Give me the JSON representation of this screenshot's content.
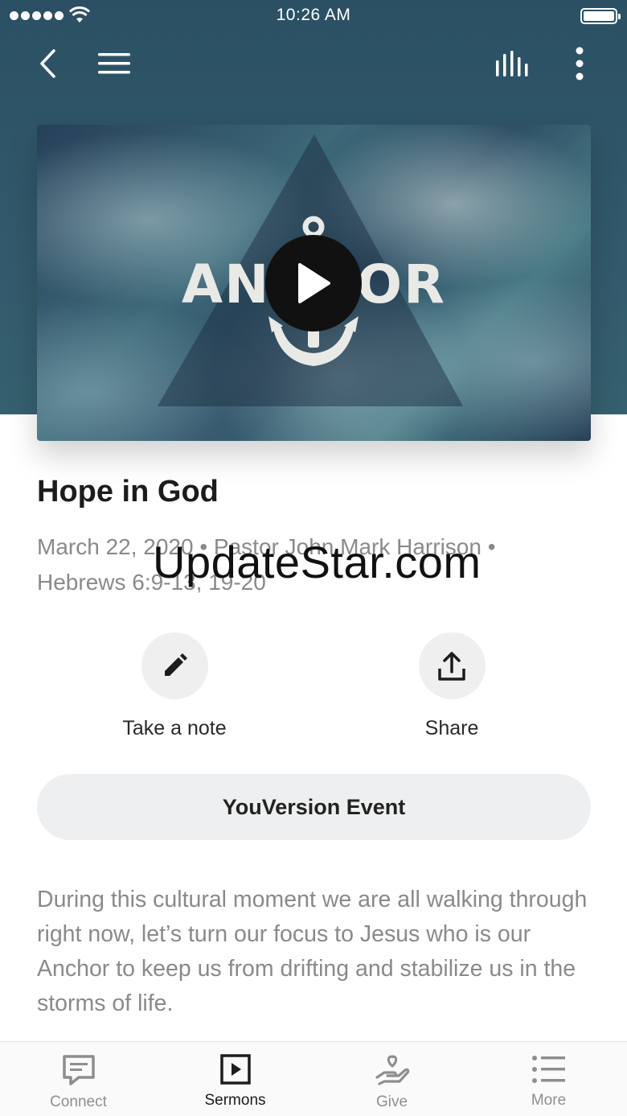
{
  "status_bar": {
    "time": "10:26 AM",
    "signal_bars": 5
  },
  "nav": {
    "back_icon": "chevron-left-icon",
    "menu_icon": "hamburger-menu-icon",
    "audio_icon": "audio-bars-icon",
    "more_icon": "more-vertical-icon"
  },
  "video": {
    "cover_text": "ANCHOR",
    "play_icon": "play-icon"
  },
  "sermon": {
    "title": "Hope in God",
    "meta_line1": "March 22, 2020 • Pastor John Mark Harrison •",
    "meta_line2": "Hebrews 6:9-13, 19-20",
    "watermark": "UpdateStar.com",
    "description": "During this cultural moment we are all walking through right now, let’s turn our focus to Jesus who is our Anchor to keep us from drifting and stabilize us in the storms of life."
  },
  "actions": {
    "note_label": "Take a note",
    "share_label": "Share",
    "event_label": "YouVersion Event"
  },
  "tabs": [
    {
      "label": "Connect",
      "icon": "message-icon",
      "active": false
    },
    {
      "label": "Sermons",
      "icon": "video-play-icon",
      "active": true
    },
    {
      "label": "Give",
      "icon": "hand-heart-icon",
      "active": false
    },
    {
      "label": "More",
      "icon": "list-icon",
      "active": false
    }
  ],
  "colors": {
    "hero": "#2b5064",
    "active_tab": "#1c1c1c",
    "inactive_tab": "#8e8e8e",
    "muted_text": "#8a8a8a"
  }
}
